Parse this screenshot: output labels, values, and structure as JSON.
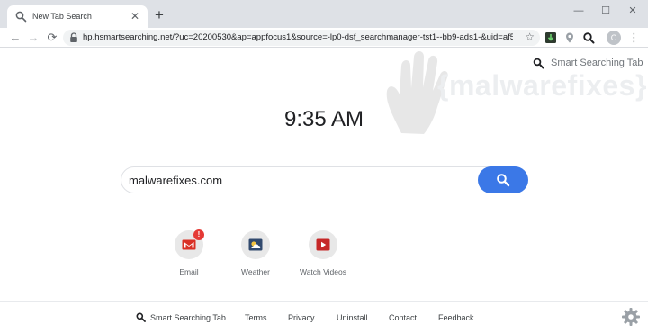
{
  "browser": {
    "tab": {
      "title": "New Tab Search",
      "close": "✕"
    },
    "new_tab": "+",
    "window": {
      "minimize": "—",
      "maximize": "☐",
      "close": "✕"
    },
    "nav": {
      "back": "←",
      "forward": "→",
      "reload": "⟳"
    },
    "url": "hp.hsmartsearching.net/?uc=20200530&ap=appfocus1&source=-lp0-dsf_searchmanager-tst1--bb9-ads1-&uid=af52...",
    "bookmark_icon": "☆",
    "profile_initial": "C",
    "menu": "⋮"
  },
  "page": {
    "brand": "Smart Searching Tab",
    "watermark": "{malwarefixes}",
    "clock": "9:35 AM",
    "search": {
      "value": "malwarefixes.com",
      "button_color": "#3b78e7"
    },
    "shortcuts": [
      {
        "label": "Email",
        "icon": "gmail-icon",
        "badge": "!"
      },
      {
        "label": "Weather",
        "icon": "weather-icon"
      },
      {
        "label": "Watch Videos",
        "icon": "video-play-icon"
      }
    ],
    "footer": {
      "brand": "Smart Searching Tab",
      "links": [
        "Terms",
        "Privacy",
        "Uninstall",
        "Contact",
        "Feedback"
      ]
    }
  }
}
